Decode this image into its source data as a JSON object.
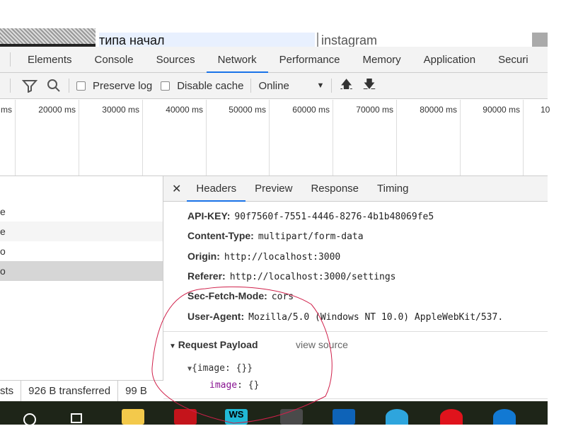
{
  "page": {
    "text1": "типа начал",
    "text2": "instagram"
  },
  "devtools": {
    "tabs": [
      "Elements",
      "Console",
      "Sources",
      "Network",
      "Performance",
      "Memory",
      "Application",
      "Securi"
    ],
    "active_tab": "Network",
    "toolbar": {
      "preserve_log": "Preserve log",
      "disable_cache": "Disable cache",
      "throttle": "Online"
    },
    "timeline_ticks": [
      "ms",
      "20000 ms",
      "30000 ms",
      "40000 ms",
      "50000 ms",
      "60000 ms",
      "70000 ms",
      "80000 ms",
      "90000 ms",
      "10"
    ],
    "requests": [
      "e",
      "e",
      "o",
      "o"
    ],
    "status": {
      "requests": "sts",
      "transferred": "926 B transferred",
      "resources": "99 B"
    },
    "detail_tabs": [
      "Headers",
      "Preview",
      "Response",
      "Timing"
    ],
    "headers": [
      {
        "name": "API-KEY:",
        "value": "90f7560f-7551-4446-8276-4b1b48069fe5"
      },
      {
        "name": "Content-Type:",
        "value": "multipart/form-data"
      },
      {
        "name": "Origin:",
        "value": "http://localhost:3000"
      },
      {
        "name": "Referer:",
        "value": "http://localhost:3000/settings"
      },
      {
        "name": "Sec-Fetch-Mode:",
        "value": "cors"
      },
      {
        "name": "User-Agent:",
        "value": "Mozilla/5.0 (Windows NT 10.0) AppleWebKit/537."
      }
    ],
    "payload": {
      "title": "Request Payload",
      "view_source": "view source",
      "object": "{image: {}}",
      "key": "image",
      "value": "{}"
    }
  },
  "colors": {
    "accent": "#1a73e8",
    "annotation": "#d0204a",
    "taskbar": "#1e2518"
  }
}
